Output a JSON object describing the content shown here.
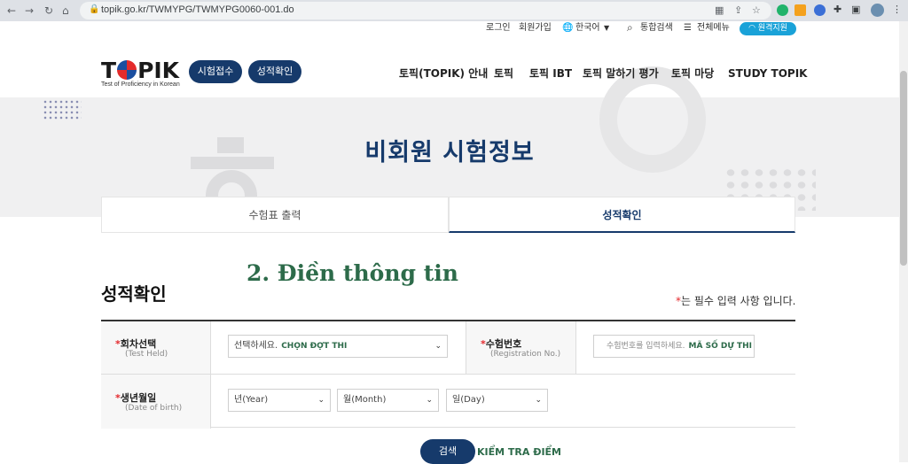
{
  "browser": {
    "url": "topik.go.kr/TWMYPG/TWMYPG0060-001.do",
    "back_icon": "arrow-left-icon",
    "forward_icon": "arrow-right-icon",
    "reload_icon": "reload-icon",
    "home_icon": "home-icon"
  },
  "utility_nav": {
    "login": "로그인",
    "signup": "회원가입",
    "language": "한국어",
    "search": "통합검색",
    "all_menu": "전체메뉴",
    "remote": "원격지원"
  },
  "header": {
    "logo_text_pre": "T",
    "logo_text_post": "PIK",
    "logo_sub": "Test of Proficiency in Korean",
    "exam_apply": "시험접수",
    "score_check": "성적확인",
    "nav": [
      "토픽(TOPIK) 안내",
      "토픽",
      "토픽 IBT",
      "토픽 말하기 평가",
      "토픽 마당",
      "STUDY TOPIK"
    ]
  },
  "banner": {
    "title": "비회원 시험정보"
  },
  "tabs": [
    {
      "label": "수험표 출력"
    },
    {
      "label": "성적확인"
    }
  ],
  "annotation": "2. Điền thông tin",
  "section": {
    "title": "성적확인",
    "required_star": "*",
    "required_text": "는 필수 입력 사항 입니다."
  },
  "form": {
    "star": "*",
    "round_label": "회차선택",
    "round_sub": "(Test Held)",
    "round_select": "선택하세요.",
    "round_note": "CHỌN ĐỢT THI",
    "reg_label": "수험번호",
    "reg_sub": "(Registration No.)",
    "reg_placeholder": "수험번호를 입력하세요.",
    "reg_note": "MÃ SỐ DỰ THI",
    "dob_label": "생년월일",
    "dob_sub": "(Date of birth)",
    "year": "년(Year)",
    "month": "월(Month)",
    "day": "일(Day)"
  },
  "search_button": "검색",
  "search_note": "KIỂM TRA ĐIỂM",
  "colors": {
    "brand": "#163a6b",
    "accent_red": "#e4282c",
    "remote_blue": "#1aa2d8",
    "annotation_green": "#2d6b4a"
  }
}
